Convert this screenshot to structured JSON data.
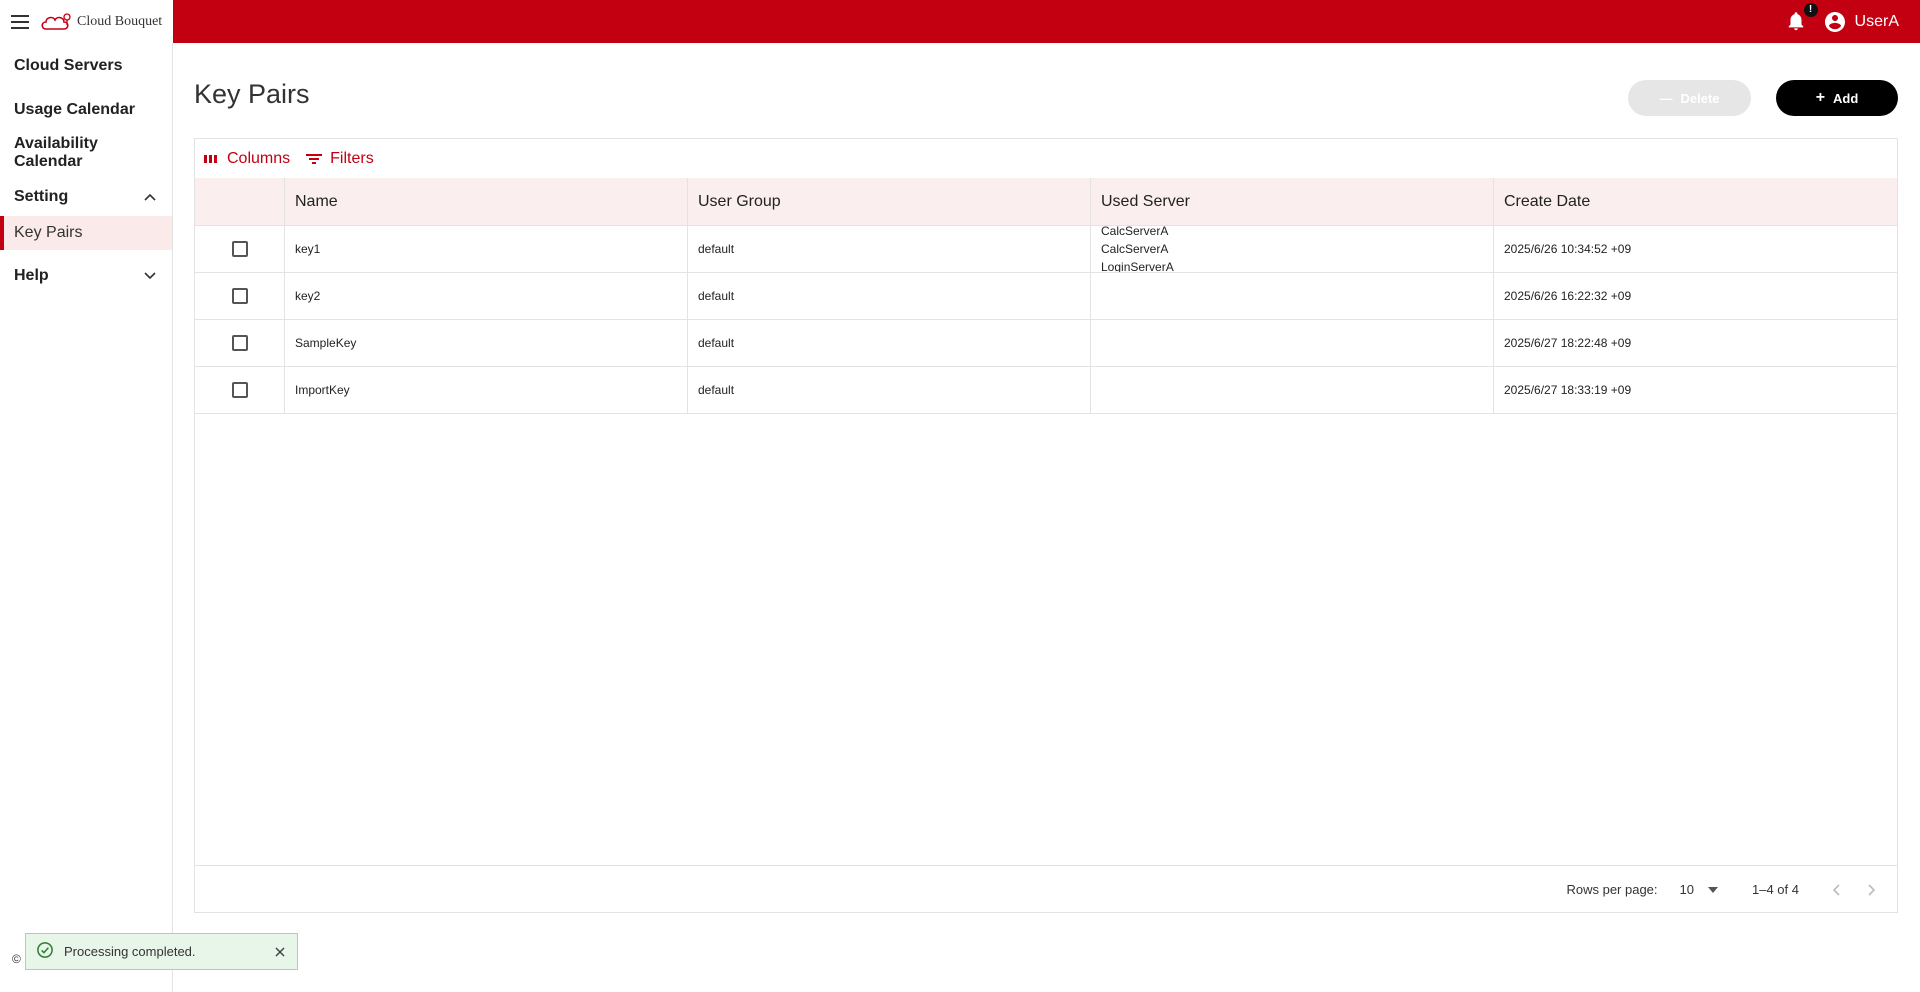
{
  "app": {
    "brand": "Cloud Bouquet"
  },
  "header": {
    "notification_count": "!",
    "user_name": "UserA"
  },
  "sidebar": {
    "items": [
      {
        "label": "Cloud Servers"
      },
      {
        "label": "Usage Calendar"
      },
      {
        "label": "Availability Calendar"
      }
    ],
    "setting": {
      "label": "Setting",
      "expanded": true,
      "children": [
        {
          "label": "Key Pairs",
          "active": true
        }
      ]
    },
    "help": {
      "label": "Help",
      "expanded": false
    }
  },
  "page": {
    "title": "Key Pairs",
    "delete_label": "Delete",
    "add_label": "Add"
  },
  "grid": {
    "toolbar": {
      "columns_label": "Columns",
      "filters_label": "Filters"
    },
    "columns": [
      "Name",
      "User Group",
      "Used Server",
      "Create Date"
    ],
    "rows": [
      {
        "name": "key1",
        "group": "default",
        "servers": [
          "CalcServerA",
          "CalcServerA",
          "LoginServerA"
        ],
        "date": "2025/6/26 10:34:52 +09"
      },
      {
        "name": "key2",
        "group": "default",
        "servers": [],
        "date": "2025/6/26 16:22:32 +09"
      },
      {
        "name": "SampleKey",
        "group": "default",
        "servers": [],
        "date": "2025/6/27 18:22:48 +09"
      },
      {
        "name": "ImportKey",
        "group": "default",
        "servers": [],
        "date": "2025/6/27 18:33:19 +09"
      }
    ],
    "footer": {
      "rows_per_page_label": "Rows per page:",
      "rows_per_page": "10",
      "range": "1–4 of 4"
    }
  },
  "toast": {
    "message": "Processing completed.",
    "status": "success"
  },
  "copyright": "©",
  "colors": {
    "brand": "#c30012",
    "header_bg": "#fbeeee",
    "selected_bg": "#fbeaea",
    "toast_bg": "#e8f5e9"
  }
}
